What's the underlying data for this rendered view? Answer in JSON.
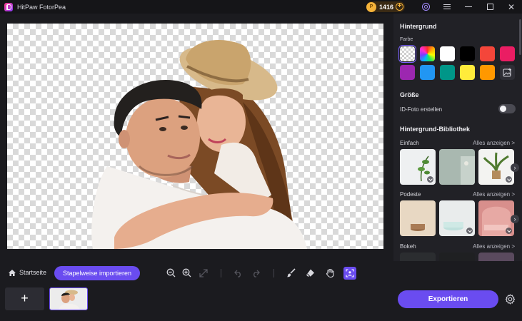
{
  "window": {
    "title": "HitPaw FotorPea",
    "coins": "1416",
    "coin_symbol": "P"
  },
  "panel": {
    "background_title": "Hintergrund",
    "color_label": "Farbe",
    "swatches": [
      {
        "kind": "transparent",
        "selected": true
      },
      {
        "kind": "rainbow"
      },
      {
        "kind": "solid",
        "color": "#ffffff"
      },
      {
        "kind": "solid",
        "color": "#000000"
      },
      {
        "kind": "solid",
        "color": "#f4463a"
      },
      {
        "kind": "solid",
        "color": "#ea1d63"
      },
      {
        "kind": "solid",
        "color": "#9c27b0"
      },
      {
        "kind": "solid",
        "color": "#2196f3"
      },
      {
        "kind": "solid",
        "color": "#009688"
      },
      {
        "kind": "solid",
        "color": "#ffeb3b"
      },
      {
        "kind": "solid",
        "color": "#ff9800"
      },
      {
        "kind": "upload"
      }
    ],
    "size_title": "Größe",
    "id_photo_label": "ID-Foto erstellen",
    "id_photo_enabled": false,
    "library_title": "Hintergrund-Bibliothek",
    "categories": [
      {
        "name": "Einfach",
        "see_all": "Alles anzeigen >"
      },
      {
        "name": "Podeste",
        "see_all": "Alles anzeigen >"
      },
      {
        "name": "Bokeh",
        "see_all": "Alles anzeigen >"
      }
    ]
  },
  "toolbar": {
    "home_label": "Startseite",
    "batch_import_label": "Stapelweise importieren"
  },
  "footer": {
    "add_label": "+",
    "export_label": "Exportieren"
  },
  "colors": {
    "accent": "#6a4cf0",
    "coin": "#f5b33a"
  }
}
